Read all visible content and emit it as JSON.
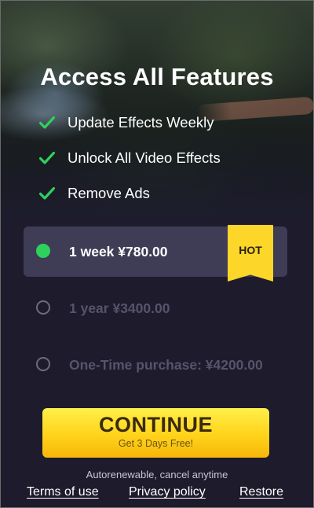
{
  "header": {
    "title": "Access All Features"
  },
  "features": [
    {
      "label": "Update Effects Weekly",
      "icon": "check-icon"
    },
    {
      "label": "Unlock All Video Effects",
      "icon": "check-icon"
    },
    {
      "label": "Remove Ads",
      "icon": "check-icon"
    }
  ],
  "plans": [
    {
      "label": "1 week ¥780.00",
      "selected": true,
      "badge": "HOT"
    },
    {
      "label": "1 year ¥3400.00",
      "selected": false
    },
    {
      "label": "One-Time purchase: ¥4200.00",
      "selected": false
    }
  ],
  "cta": {
    "label": "CONTINUE",
    "sublabel": "Get 3 Days Free!"
  },
  "footer": {
    "note": "Autorenewable, cancel anytime",
    "links": {
      "terms": "Terms of use",
      "privacy": "Privacy policy",
      "restore": "Restore"
    }
  },
  "colors": {
    "background": "#1d1b2c",
    "check": "#2ed15c",
    "selected_plan_bg": "#3f3d56",
    "badge": "#fcd628",
    "cta": "#ffd31a"
  }
}
